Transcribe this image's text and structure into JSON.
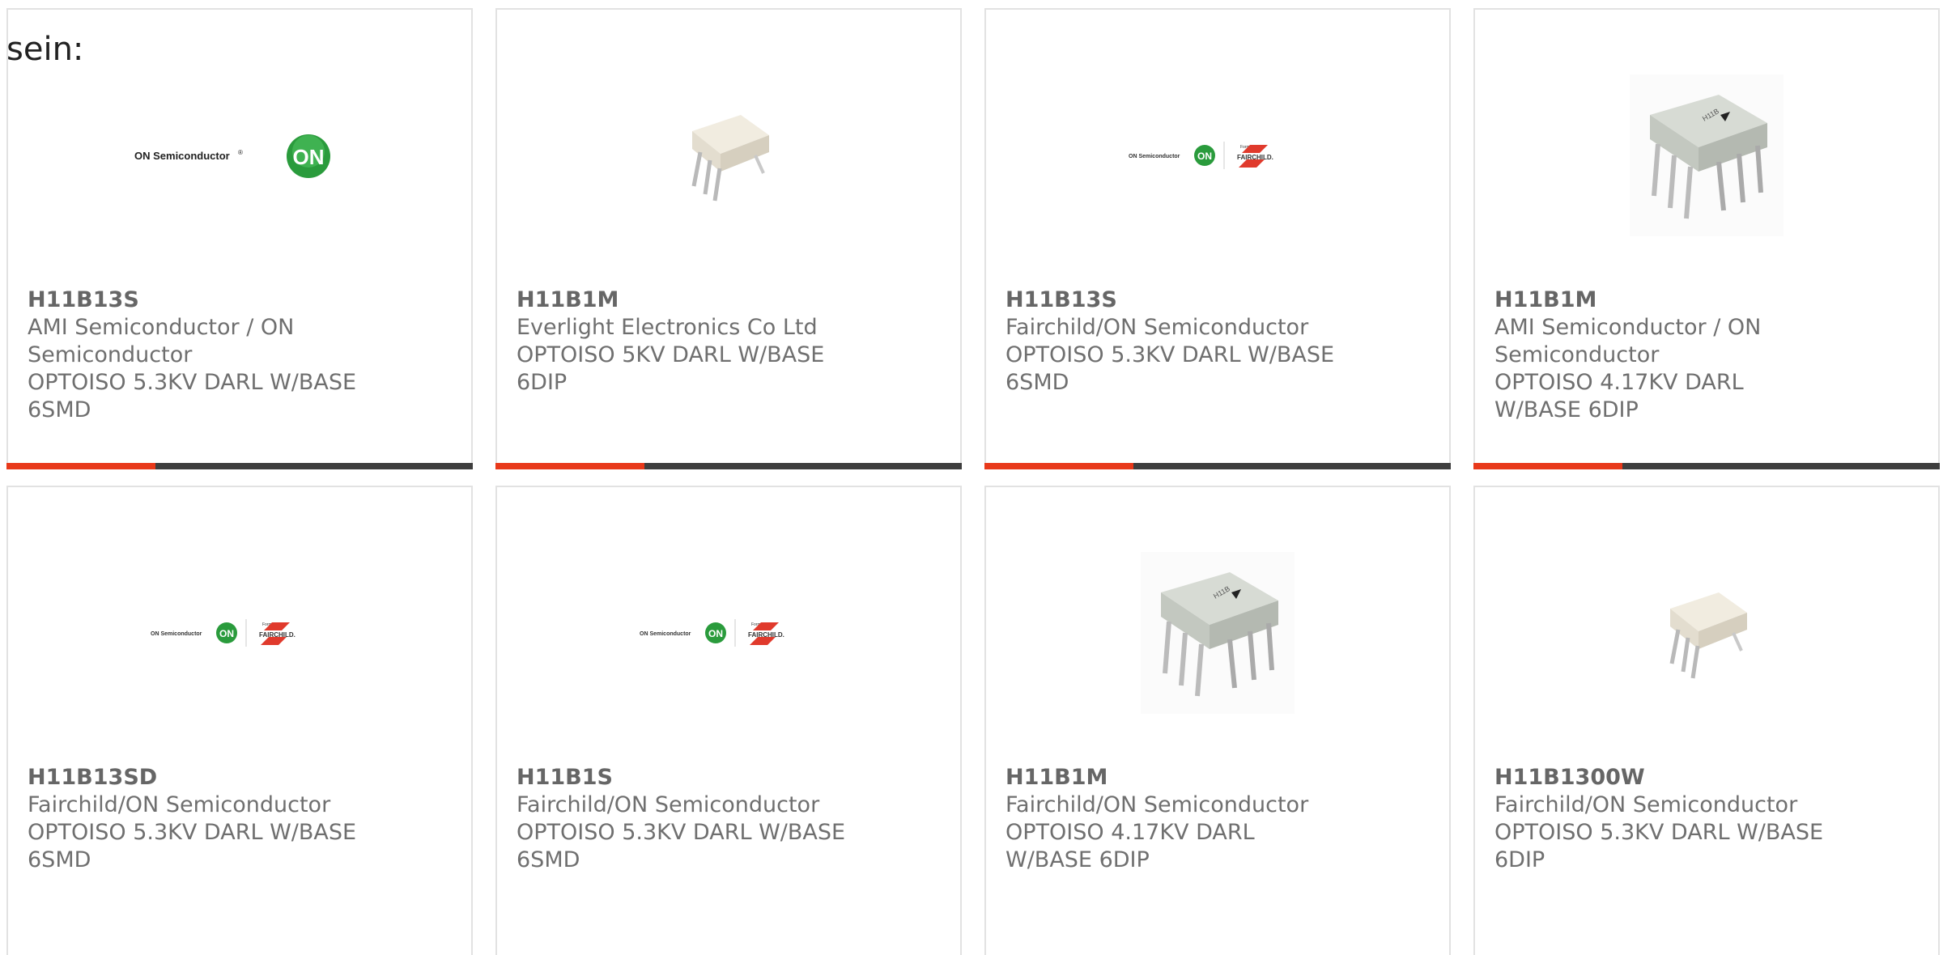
{
  "prefix_text": "sein:",
  "cards": [
    {
      "part": "H11B13S",
      "maker": "AMI Semiconductor / ON Semiconductor",
      "desc": "OPTOISO 5.3KV DARL W/BASE 6SMD",
      "image": "on-semi-logo"
    },
    {
      "part": "H11B1M",
      "maker": "Everlight Electronics Co Ltd",
      "desc": "OPTOISO 5KV DARL W/BASE 6DIP",
      "image": "white-dip-chip"
    },
    {
      "part": "H11B13S",
      "maker": "Fairchild/ON Semiconductor",
      "desc": "OPTOISO 5.3KV DARL W/BASE 6SMD",
      "image": "on-fairchild-logo"
    },
    {
      "part": "H11B1M",
      "maker": "AMI Semiconductor / ON Semiconductor",
      "desc": "OPTOISO 4.17KV DARL W/BASE 6DIP",
      "image": "gray-dip-chip"
    },
    {
      "part": "H11B13SD",
      "maker": "Fairchild/ON Semiconductor",
      "desc": "OPTOISO 5.3KV DARL W/BASE 6SMD",
      "image": "on-fairchild-logo"
    },
    {
      "part": "H11B1S",
      "maker": "Fairchild/ON Semiconductor",
      "desc": "OPTOISO 5.3KV DARL W/BASE 6SMD",
      "image": "on-fairchild-logo"
    },
    {
      "part": "H11B1M",
      "maker": "Fairchild/ON Semiconductor",
      "desc": "OPTOISO 4.17KV DARL W/BASE 6DIP",
      "image": "gray-dip-chip"
    },
    {
      "part": "H11B1300W",
      "maker": "Fairchild/ON Semiconductor",
      "desc": "OPTOISO 5.3KV DARL W/BASE 6DIP",
      "image": "white-dip-chip"
    }
  ],
  "logo_text": {
    "on_semi": "ON Semiconductor",
    "on_badge": "ON",
    "formerly": "Formerly",
    "fairchild": "FAIRCHILD."
  },
  "colors": {
    "accent_bar": "#e8391a",
    "dark_bar": "#3e3e3e",
    "on_green": "#2a9b3c",
    "fairchild_red": "#e03a2c"
  }
}
